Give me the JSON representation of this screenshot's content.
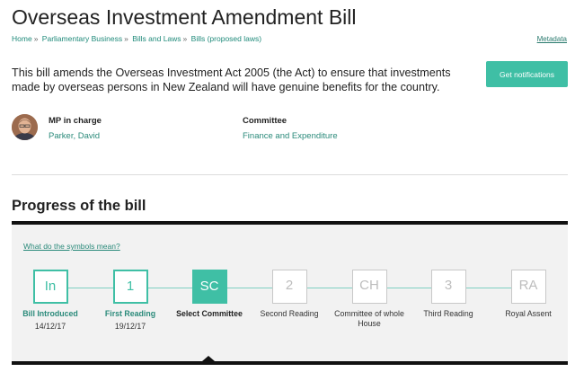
{
  "bill": {
    "title": "Overseas Investment Amendment Bill",
    "summary": "This bill amends the Overseas Investment Act 2005 (the Act) to ensure that investments made by overseas persons in New Zealand will have genuine benefits for the country."
  },
  "breadcrumb": [
    {
      "label": "Home"
    },
    {
      "label": "Parliamentary Business"
    },
    {
      "label": "Bills and Laws"
    },
    {
      "label": "Bills (proposed laws)"
    }
  ],
  "breadcrumb_separator": "»",
  "metadata_link": "Metadata",
  "notify_button": "Get notifications",
  "mp": {
    "label": "MP in charge",
    "name": "Parker, David"
  },
  "committee": {
    "label": "Committee",
    "name": "Finance and Expenditure"
  },
  "progress": {
    "heading": "Progress of the bill",
    "symbols_link": "What do the symbols mean?",
    "stages": [
      {
        "code": "In",
        "name": "Bill Introduced",
        "date": "14/12/17",
        "status": "done"
      },
      {
        "code": "1",
        "name": "First Reading",
        "date": "19/12/17",
        "status": "done"
      },
      {
        "code": "SC",
        "name": "Select Committee",
        "date": "",
        "status": "current"
      },
      {
        "code": "2",
        "name": "Second Reading",
        "date": "",
        "status": "future"
      },
      {
        "code": "CH",
        "name": "Committee of whole House",
        "date": "",
        "status": "future"
      },
      {
        "code": "3",
        "name": "Third Reading",
        "date": "",
        "status": "future"
      },
      {
        "code": "RA",
        "name": "Royal Assent",
        "date": "",
        "status": "future"
      }
    ]
  },
  "colors": {
    "accent": "#3fbfa5",
    "link": "#2a8a7a",
    "future": "#c8c8c8"
  },
  "icons": {
    "pointer": "triangle-up-icon",
    "avatar": "person-photo"
  }
}
